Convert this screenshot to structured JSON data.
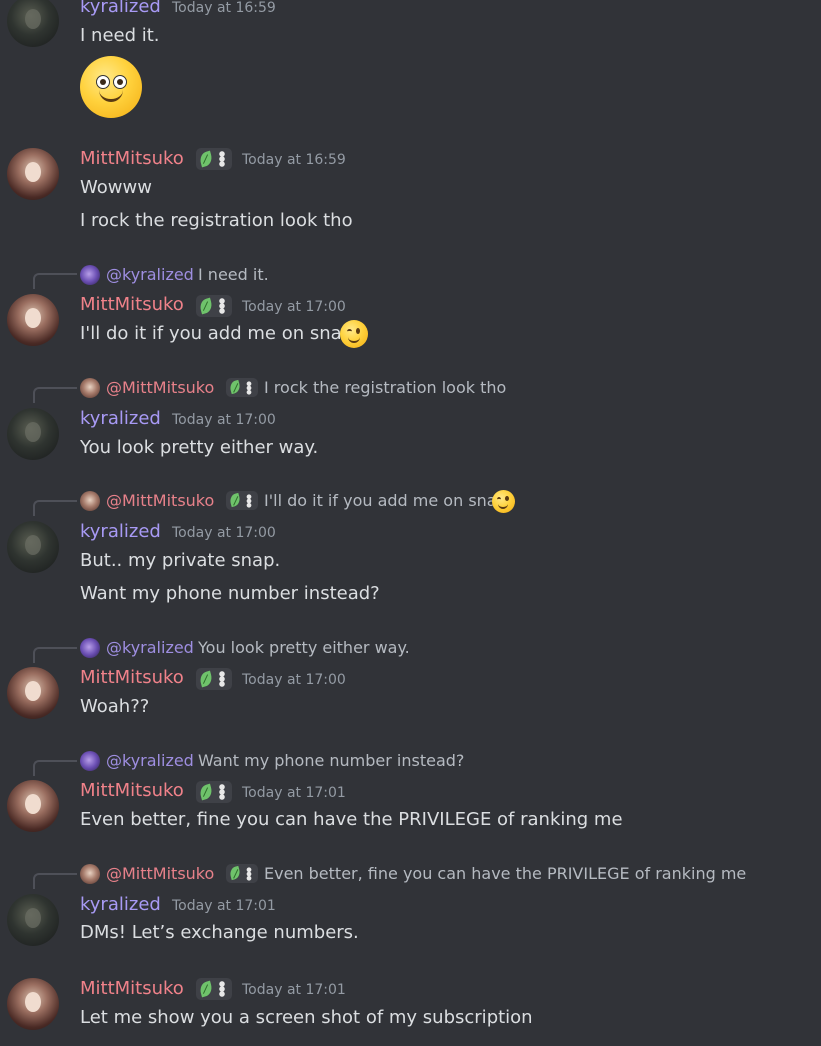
{
  "users": {
    "kyra": {
      "name": "kyralized",
      "mention": "@kyralized"
    },
    "mitt": {
      "name": "MittMitsuko",
      "mention": "@MittMitsuko"
    }
  },
  "messages": [
    {
      "author": "kyralized",
      "timestamp": "Today at 16:59",
      "lines": [
        "I need it."
      ],
      "emoji": "slightly-smiling-face"
    },
    {
      "author": "MittMitsuko",
      "timestamp": "Today at 16:59",
      "lines": [
        "Wowww",
        "I rock the registration look tho"
      ]
    },
    {
      "author": "MittMitsuko",
      "timestamp": "Today at 17:00",
      "reply": {
        "to": "@kyralized",
        "text": "I need it."
      },
      "lines": [
        "I'll do it if you add me on snap"
      ]
    },
    {
      "author": "kyralized",
      "timestamp": "Today at 17:00",
      "reply": {
        "to": "@MittMitsuko",
        "text": "I rock the registration look tho"
      },
      "lines": [
        "You look pretty either way."
      ]
    },
    {
      "author": "kyralized",
      "timestamp": "Today at 17:00",
      "reply": {
        "to": "@MittMitsuko",
        "text": "I'll do it if you add me on snap"
      },
      "lines": [
        "But.. my private snap.",
        "Want my phone number instead?"
      ]
    },
    {
      "author": "MittMitsuko",
      "timestamp": "Today at 17:00",
      "reply": {
        "to": "@kyralized",
        "text": "You look pretty either way."
      },
      "lines": [
        "Woah??"
      ]
    },
    {
      "author": "MittMitsuko",
      "timestamp": "Today at 17:01",
      "reply": {
        "to": "@kyralized",
        "text": "Want my phone number instead?"
      },
      "lines": [
        "Even better, fine you can have the PRIVILEGE of ranking me"
      ]
    },
    {
      "author": "kyralized",
      "timestamp": "Today at 17:01",
      "reply": {
        "to": "@MittMitsuko",
        "text": "Even better, fine you can have the PRIVILEGE of ranking me"
      },
      "lines": [
        "DMs! Let’s exchange numbers."
      ]
    },
    {
      "author": "MittMitsuko",
      "timestamp": "Today at 17:01",
      "lines": [
        "Let me show you a screen shot of my subscription"
      ]
    }
  ],
  "colors": {
    "background": "#313338",
    "kyra_name": "#a89af5",
    "mitt_name": "#f0828a",
    "timestamp": "#949ba4"
  }
}
